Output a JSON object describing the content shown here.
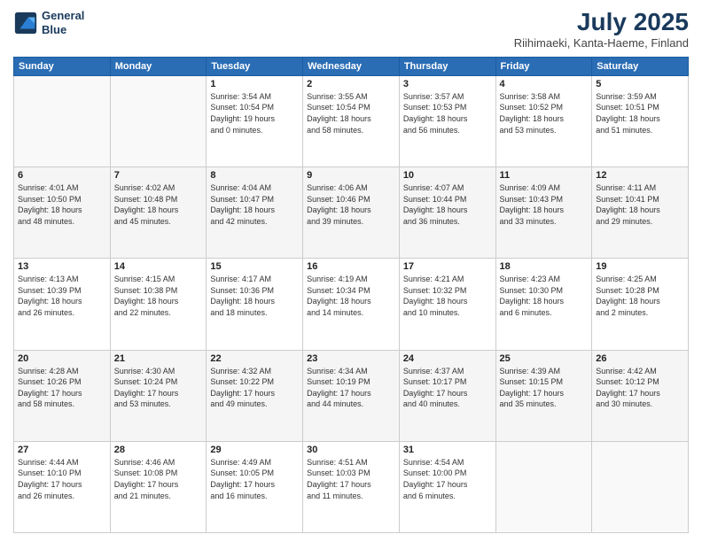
{
  "header": {
    "logo_line1": "General",
    "logo_line2": "Blue",
    "title": "July 2025",
    "subtitle": "Riihimaeki, Kanta-Haeme, Finland"
  },
  "days_of_week": [
    "Sunday",
    "Monday",
    "Tuesday",
    "Wednesday",
    "Thursday",
    "Friday",
    "Saturday"
  ],
  "weeks": [
    [
      {
        "day": "",
        "info": ""
      },
      {
        "day": "",
        "info": ""
      },
      {
        "day": "1",
        "info": "Sunrise: 3:54 AM\nSunset: 10:54 PM\nDaylight: 19 hours\nand 0 minutes."
      },
      {
        "day": "2",
        "info": "Sunrise: 3:55 AM\nSunset: 10:54 PM\nDaylight: 18 hours\nand 58 minutes."
      },
      {
        "day": "3",
        "info": "Sunrise: 3:57 AM\nSunset: 10:53 PM\nDaylight: 18 hours\nand 56 minutes."
      },
      {
        "day": "4",
        "info": "Sunrise: 3:58 AM\nSunset: 10:52 PM\nDaylight: 18 hours\nand 53 minutes."
      },
      {
        "day": "5",
        "info": "Sunrise: 3:59 AM\nSunset: 10:51 PM\nDaylight: 18 hours\nand 51 minutes."
      }
    ],
    [
      {
        "day": "6",
        "info": "Sunrise: 4:01 AM\nSunset: 10:50 PM\nDaylight: 18 hours\nand 48 minutes."
      },
      {
        "day": "7",
        "info": "Sunrise: 4:02 AM\nSunset: 10:48 PM\nDaylight: 18 hours\nand 45 minutes."
      },
      {
        "day": "8",
        "info": "Sunrise: 4:04 AM\nSunset: 10:47 PM\nDaylight: 18 hours\nand 42 minutes."
      },
      {
        "day": "9",
        "info": "Sunrise: 4:06 AM\nSunset: 10:46 PM\nDaylight: 18 hours\nand 39 minutes."
      },
      {
        "day": "10",
        "info": "Sunrise: 4:07 AM\nSunset: 10:44 PM\nDaylight: 18 hours\nand 36 minutes."
      },
      {
        "day": "11",
        "info": "Sunrise: 4:09 AM\nSunset: 10:43 PM\nDaylight: 18 hours\nand 33 minutes."
      },
      {
        "day": "12",
        "info": "Sunrise: 4:11 AM\nSunset: 10:41 PM\nDaylight: 18 hours\nand 29 minutes."
      }
    ],
    [
      {
        "day": "13",
        "info": "Sunrise: 4:13 AM\nSunset: 10:39 PM\nDaylight: 18 hours\nand 26 minutes."
      },
      {
        "day": "14",
        "info": "Sunrise: 4:15 AM\nSunset: 10:38 PM\nDaylight: 18 hours\nand 22 minutes."
      },
      {
        "day": "15",
        "info": "Sunrise: 4:17 AM\nSunset: 10:36 PM\nDaylight: 18 hours\nand 18 minutes."
      },
      {
        "day": "16",
        "info": "Sunrise: 4:19 AM\nSunset: 10:34 PM\nDaylight: 18 hours\nand 14 minutes."
      },
      {
        "day": "17",
        "info": "Sunrise: 4:21 AM\nSunset: 10:32 PM\nDaylight: 18 hours\nand 10 minutes."
      },
      {
        "day": "18",
        "info": "Sunrise: 4:23 AM\nSunset: 10:30 PM\nDaylight: 18 hours\nand 6 minutes."
      },
      {
        "day": "19",
        "info": "Sunrise: 4:25 AM\nSunset: 10:28 PM\nDaylight: 18 hours\nand 2 minutes."
      }
    ],
    [
      {
        "day": "20",
        "info": "Sunrise: 4:28 AM\nSunset: 10:26 PM\nDaylight: 17 hours\nand 58 minutes."
      },
      {
        "day": "21",
        "info": "Sunrise: 4:30 AM\nSunset: 10:24 PM\nDaylight: 17 hours\nand 53 minutes."
      },
      {
        "day": "22",
        "info": "Sunrise: 4:32 AM\nSunset: 10:22 PM\nDaylight: 17 hours\nand 49 minutes."
      },
      {
        "day": "23",
        "info": "Sunrise: 4:34 AM\nSunset: 10:19 PM\nDaylight: 17 hours\nand 44 minutes."
      },
      {
        "day": "24",
        "info": "Sunrise: 4:37 AM\nSunset: 10:17 PM\nDaylight: 17 hours\nand 40 minutes."
      },
      {
        "day": "25",
        "info": "Sunrise: 4:39 AM\nSunset: 10:15 PM\nDaylight: 17 hours\nand 35 minutes."
      },
      {
        "day": "26",
        "info": "Sunrise: 4:42 AM\nSunset: 10:12 PM\nDaylight: 17 hours\nand 30 minutes."
      }
    ],
    [
      {
        "day": "27",
        "info": "Sunrise: 4:44 AM\nSunset: 10:10 PM\nDaylight: 17 hours\nand 26 minutes."
      },
      {
        "day": "28",
        "info": "Sunrise: 4:46 AM\nSunset: 10:08 PM\nDaylight: 17 hours\nand 21 minutes."
      },
      {
        "day": "29",
        "info": "Sunrise: 4:49 AM\nSunset: 10:05 PM\nDaylight: 17 hours\nand 16 minutes."
      },
      {
        "day": "30",
        "info": "Sunrise: 4:51 AM\nSunset: 10:03 PM\nDaylight: 17 hours\nand 11 minutes."
      },
      {
        "day": "31",
        "info": "Sunrise: 4:54 AM\nSunset: 10:00 PM\nDaylight: 17 hours\nand 6 minutes."
      },
      {
        "day": "",
        "info": ""
      },
      {
        "day": "",
        "info": ""
      }
    ]
  ]
}
